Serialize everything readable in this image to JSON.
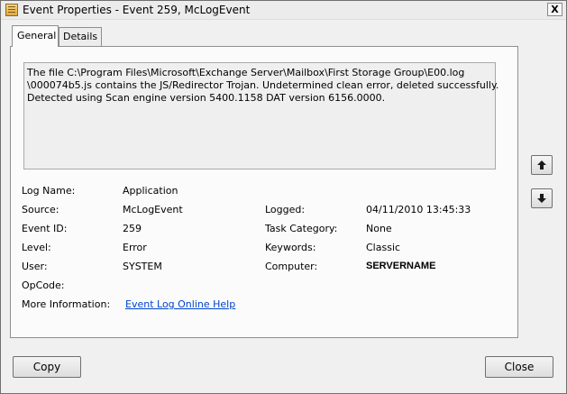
{
  "window": {
    "title": "Event Properties - Event 259, McLogEvent",
    "close_glyph": "X"
  },
  "tabs": [
    {
      "label": "General"
    },
    {
      "label": "Details"
    }
  ],
  "description": {
    "line1": "The file C:\\Program Files\\Microsoft\\Exchange Server\\Mailbox\\First Storage Group\\E00.log",
    "line2": "\\000074b5.js contains the JS/Redirector Trojan. Undetermined clean error, deleted successfully.",
    "line3": "Detected using Scan engine version 5400.1158 DAT version 6156.0000."
  },
  "fields": {
    "log_name": {
      "label": "Log Name:",
      "value": "Application"
    },
    "source": {
      "label": "Source:",
      "value": "McLogEvent"
    },
    "event_id": {
      "label": "Event ID:",
      "value": "259"
    },
    "level": {
      "label": "Level:",
      "value": "Error"
    },
    "user": {
      "label": "User:",
      "value": "SYSTEM"
    },
    "opcode": {
      "label": "OpCode:",
      "value": ""
    },
    "more_info": {
      "label": "More Information:",
      "value": "Event Log Online Help"
    },
    "logged": {
      "label": "Logged:",
      "value": "04/11/2010 13:45:33"
    },
    "task_category": {
      "label": "Task Category:",
      "value": "None"
    },
    "keywords": {
      "label": "Keywords:",
      "value": "Classic"
    },
    "computer": {
      "label": "Computer:",
      "value": "SERVERNAME"
    }
  },
  "buttons": {
    "copy": "Copy",
    "close": "Close"
  },
  "icons": {
    "up": "arrow-up-icon",
    "down": "arrow-down-icon"
  }
}
